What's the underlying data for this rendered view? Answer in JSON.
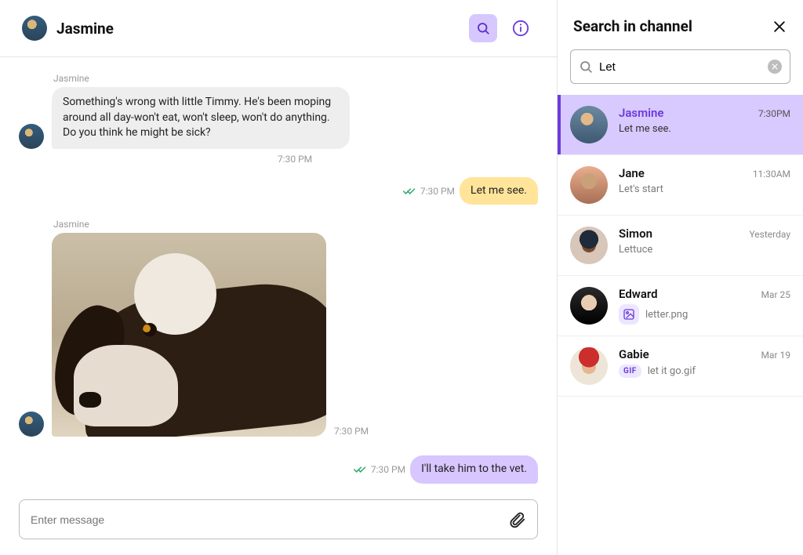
{
  "header": {
    "contact_name": "Jasmine"
  },
  "chat": {
    "m1_sender": "Jasmine",
    "m1_text": "Something's wrong with little Timmy. He's been moping around all day-won't eat, won't sleep, won't do anything. Do you think he might be sick?",
    "m1_time": "7:30 PM",
    "m2_text": "Let me see.",
    "m2_time": "7:30 PM",
    "m3_sender": "Jasmine",
    "m3_time": "7:30 PM",
    "m4_text": "I'll take him to the vet.",
    "m4_time": "7:30 PM",
    "composer_placeholder": "Enter message"
  },
  "panel": {
    "title": "Search in channel",
    "query": "Let",
    "results": [
      {
        "name": "Jasmine",
        "time": "7:30PM",
        "snippet": "Let me see."
      },
      {
        "name": "Jane",
        "time": "11:30AM",
        "snippet": "Let's start"
      },
      {
        "name": "Simon",
        "time": "Yesterday",
        "snippet": "Lettuce"
      },
      {
        "name": "Edward",
        "time": "Mar 25",
        "snippet": "letter.png"
      },
      {
        "name": "Gabie",
        "time": "Mar 19",
        "snippet": "let it go.gif"
      }
    ],
    "gif_chip": "GIF"
  }
}
